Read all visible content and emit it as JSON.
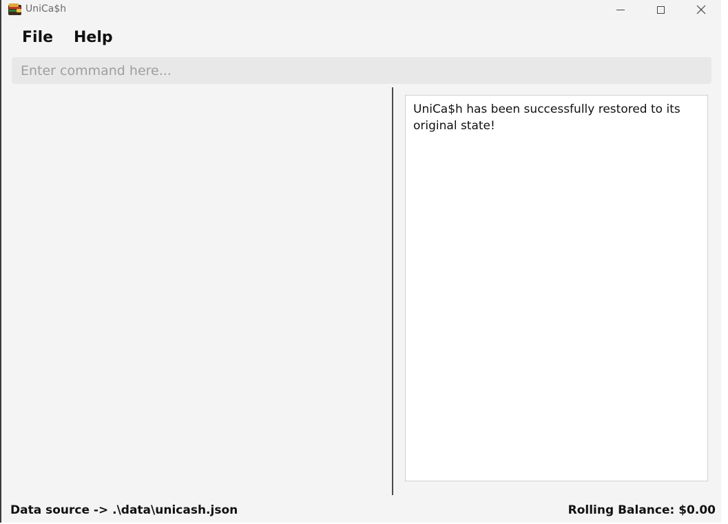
{
  "window": {
    "title": "UniCa$h",
    "controls": {
      "minimize_icon": "minimize-icon",
      "maximize_icon": "maximize-icon",
      "close_icon": "close-icon"
    }
  },
  "menu": {
    "items": [
      {
        "label": "File"
      },
      {
        "label": "Help"
      }
    ]
  },
  "command": {
    "value": "",
    "placeholder": "Enter command here..."
  },
  "result": {
    "message": "UniCa$h has been successfully restored to its original state!"
  },
  "status": {
    "data_source": "Data source -> .\\data\\unicash.json",
    "rolling_balance": "Rolling Balance: $0.00"
  },
  "colors": {
    "window_bg": "#f4f4f4",
    "command_bg": "#e9e8e8",
    "result_bg": "#ffffff",
    "divider": "#4a4a4a"
  }
}
